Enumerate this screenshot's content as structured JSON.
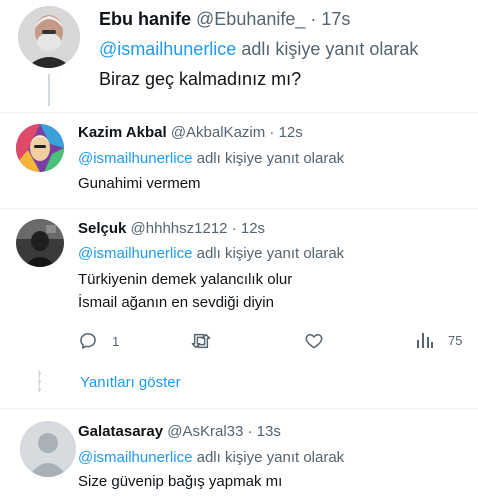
{
  "tweets": [
    {
      "name": "Ebu hanife",
      "handle": "@Ebuhanife_",
      "time": "· 17s",
      "mention": "@ismailhunerlice",
      "reply_suffix": "adlı kişiye yanıt olarak",
      "lines": [
        "Biraz geç kalmadınız mı?"
      ]
    },
    {
      "name": "Kazim Akbal",
      "handle": "@AkbalKazim",
      "time": "· 12s",
      "mention": "@ismailhunerlice",
      "reply_suffix": "adlı kişiye yanıt olarak",
      "lines": [
        "Gunahimi vermem"
      ]
    },
    {
      "name": "Selçuk",
      "handle": "@hhhhsz1212",
      "time": "· 12s",
      "mention": "@ismailhunerlice",
      "reply_suffix": "adlı kişiye yanıt olarak",
      "lines": [
        "Türkiyenin demek yalancılık olur",
        "İsmail ağanın en sevdiği diyin"
      ],
      "actions": {
        "reply_count": "1",
        "views_count": "75"
      }
    },
    {
      "name": "Galatasaray",
      "handle": "@AsKral33",
      "time": "· 13s",
      "mention": "@ismailhunerlice",
      "reply_suffix": "adlı kişiye yanıt olarak",
      "lines": [
        "Size güvenip bağış yapmak mı"
      ]
    }
  ],
  "show_replies": "Yanıtları göster",
  "colors": {
    "accent": "#1d9bf0",
    "secondary": "#536471",
    "divider": "#eff3f4"
  }
}
